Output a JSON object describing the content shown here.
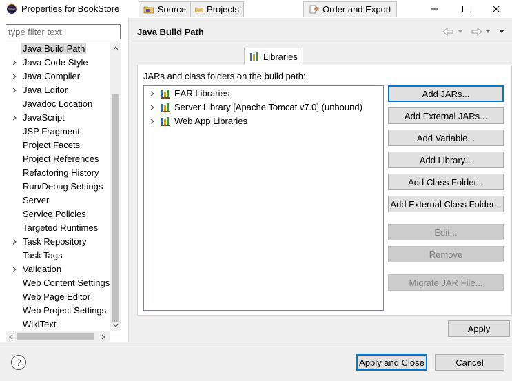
{
  "window": {
    "title": "Properties for BookStore",
    "app_icon": "eclipse-icon",
    "controls": [
      "minimize-icon",
      "maximize-icon",
      "close-icon"
    ]
  },
  "filter": {
    "placeholder": "type filter text",
    "value": ""
  },
  "sidebar": {
    "items": [
      {
        "label": "Java Build Path",
        "expandable": false,
        "selected": true
      },
      {
        "label": "Java Code Style",
        "expandable": true
      },
      {
        "label": "Java Compiler",
        "expandable": true
      },
      {
        "label": "Java Editor",
        "expandable": true
      },
      {
        "label": "Javadoc Location",
        "expandable": false
      },
      {
        "label": "JavaScript",
        "expandable": true
      },
      {
        "label": "JSP Fragment",
        "expandable": false
      },
      {
        "label": "Project Facets",
        "expandable": false
      },
      {
        "label": "Project References",
        "expandable": false
      },
      {
        "label": "Refactoring History",
        "expandable": false
      },
      {
        "label": "Run/Debug Settings",
        "expandable": false
      },
      {
        "label": "Server",
        "expandable": false
      },
      {
        "label": "Service Policies",
        "expandable": false
      },
      {
        "label": "Targeted Runtimes",
        "expandable": false
      },
      {
        "label": "Task Repository",
        "expandable": true
      },
      {
        "label": "Task Tags",
        "expandable": false
      },
      {
        "label": "Validation",
        "expandable": true
      },
      {
        "label": "Web Content Settings",
        "expandable": false
      },
      {
        "label": "Web Page Editor",
        "expandable": false
      },
      {
        "label": "Web Project Settings",
        "expandable": false
      },
      {
        "label": "WikiText",
        "expandable": false
      }
    ]
  },
  "page": {
    "title": "Java Build Path",
    "nav_icons": [
      "back-arrow-icon",
      "back-dropdown-icon",
      "forward-arrow-icon",
      "forward-dropdown-icon",
      "view-menu-icon"
    ]
  },
  "tabs": [
    {
      "label": "Source",
      "icon": "source-folder-icon",
      "active": false
    },
    {
      "label": "Projects",
      "icon": "projects-folder-icon",
      "active": false
    },
    {
      "label": "Libraries",
      "icon": "libraries-icon",
      "active": true
    },
    {
      "label": "Order and Export",
      "icon": "order-export-icon",
      "active": false
    }
  ],
  "libraries_panel": {
    "label": "JARs and class folders on the build path:",
    "items": [
      {
        "label": "EAR Libraries"
      },
      {
        "label": "Server Library [Apache Tomcat v7.0] (unbound)"
      },
      {
        "label": "Web App Libraries"
      }
    ],
    "buttons": {
      "add_jars": "Add JARs...",
      "add_external_jars": "Add External JARs...",
      "add_variable": "Add Variable...",
      "add_library": "Add Library...",
      "add_class_folder": "Add Class Folder...",
      "add_external_class_folder": "Add External Class Folder...",
      "edit": "Edit...",
      "remove": "Remove",
      "migrate_jar": "Migrate JAR File..."
    }
  },
  "footer": {
    "apply": "Apply",
    "apply_and_close": "Apply and Close",
    "cancel": "Cancel",
    "help_icon": "help-icon"
  },
  "colors": {
    "default_button_border": "#0078d7",
    "selection_bg": "#d9d9d9",
    "disabled_text": "#838383"
  }
}
